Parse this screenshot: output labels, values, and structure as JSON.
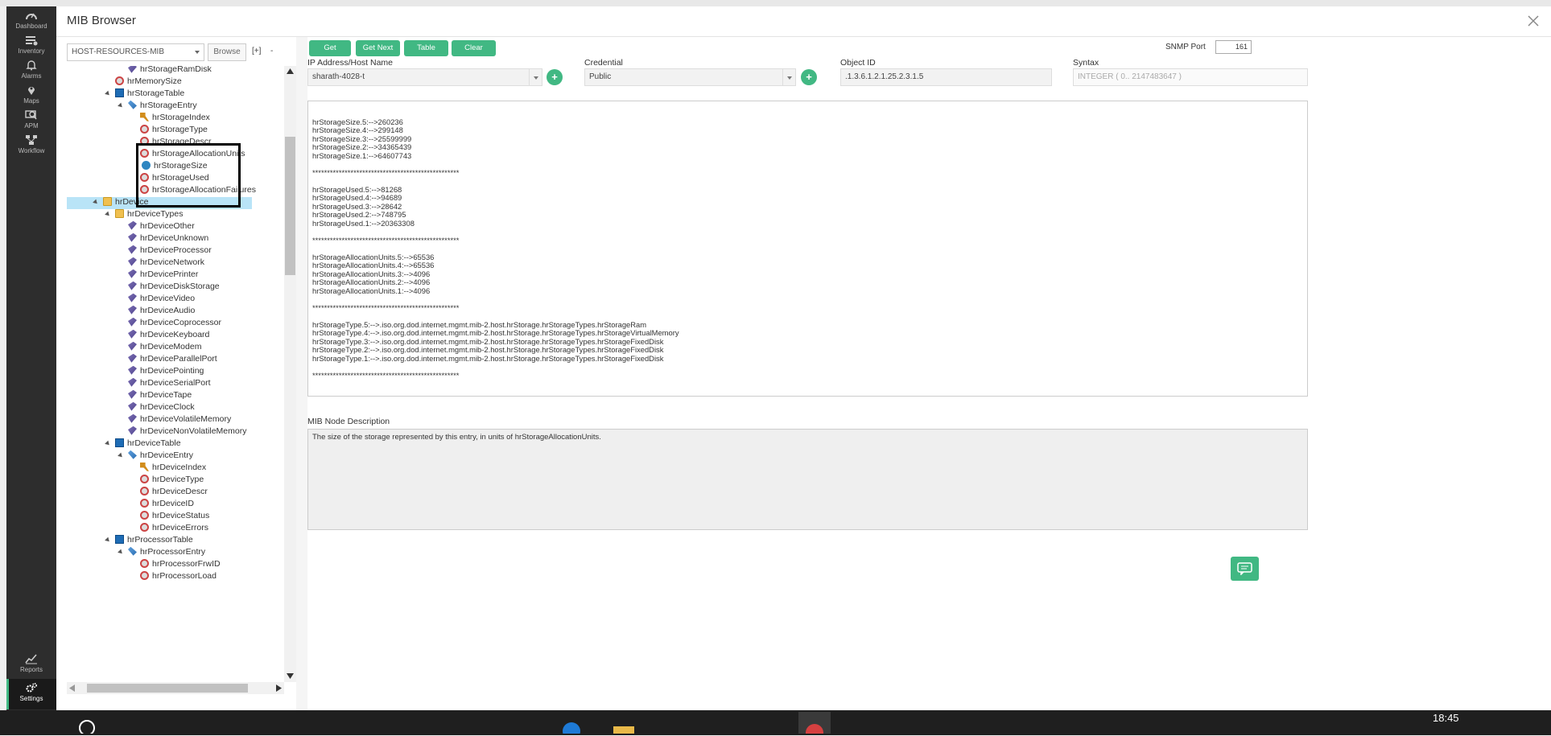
{
  "nav": {
    "items": [
      {
        "label": "Dashboard"
      },
      {
        "label": "Inventory"
      },
      {
        "label": "Alarms"
      },
      {
        "label": "Maps"
      },
      {
        "label": "APM"
      },
      {
        "label": "Workflow"
      },
      {
        "label": "Reports"
      },
      {
        "label": "Settings"
      }
    ]
  },
  "header": {
    "title": "MIB Browser"
  },
  "mib": {
    "selected": "HOST-RESOURCES-MIB",
    "browse_label": "Browse",
    "expand_label": "[+]",
    "collapse_label": "-"
  },
  "tree": {
    "nodes": [
      {
        "label": "hrStorageRamDisk"
      },
      {
        "label": "hrMemorySize"
      },
      {
        "label": "hrStorageTable"
      },
      {
        "label": "hrStorageEntry"
      },
      {
        "label": "hrStorageIndex"
      },
      {
        "label": "hrStorageType"
      },
      {
        "label": "hrStorageDescr"
      },
      {
        "label": "hrStorageAllocationUnits"
      },
      {
        "label": "hrStorageSize"
      },
      {
        "label": "hrStorageUsed"
      },
      {
        "label": "hrStorageAllocationFailures"
      },
      {
        "label": "hrDevice"
      },
      {
        "label": "hrDeviceTypes"
      },
      {
        "label": "hrDeviceOther"
      },
      {
        "label": "hrDeviceUnknown"
      },
      {
        "label": "hrDeviceProcessor"
      },
      {
        "label": "hrDeviceNetwork"
      },
      {
        "label": "hrDevicePrinter"
      },
      {
        "label": "hrDeviceDiskStorage"
      },
      {
        "label": "hrDeviceVideo"
      },
      {
        "label": "hrDeviceAudio"
      },
      {
        "label": "hrDeviceCoprocessor"
      },
      {
        "label": "hrDeviceKeyboard"
      },
      {
        "label": "hrDeviceModem"
      },
      {
        "label": "hrDeviceParallelPort"
      },
      {
        "label": "hrDevicePointing"
      },
      {
        "label": "hrDeviceSerialPort"
      },
      {
        "label": "hrDeviceTape"
      },
      {
        "label": "hrDeviceClock"
      },
      {
        "label": "hrDeviceVolatileMemory"
      },
      {
        "label": "hrDeviceNonVolatileMemory"
      },
      {
        "label": "hrDeviceTable"
      },
      {
        "label": "hrDeviceEntry"
      },
      {
        "label": "hrDeviceIndex"
      },
      {
        "label": "hrDeviceType"
      },
      {
        "label": "hrDeviceDescr"
      },
      {
        "label": "hrDeviceID"
      },
      {
        "label": "hrDeviceStatus"
      },
      {
        "label": "hrDeviceErrors"
      },
      {
        "label": "hrProcessorTable"
      },
      {
        "label": "hrProcessorEntry"
      },
      {
        "label": "hrProcessorFrwID"
      },
      {
        "label": "hrProcessorLoad"
      }
    ]
  },
  "toolbar": {
    "get": "Get",
    "get_next": "Get Next",
    "table": "Table",
    "clear": "Clear",
    "snmp_port_label": "SNMP Port",
    "snmp_port_value": "161"
  },
  "form": {
    "ip_label": "IP Address/Host Name",
    "ip_value": "sharath-4028-t",
    "credential_label": "Credential",
    "credential_value": "Public",
    "oid_label": "Object ID",
    "oid_value": ".1.3.6.1.2.1.25.2.3.1.5",
    "syntax_label": "Syntax",
    "syntax_value": "INTEGER ( 0.. 2147483647 )",
    "add_label": "+"
  },
  "output": {
    "text": "\nhrStorageSize.5:-->260236\nhrStorageSize.4:-->299148\nhrStorageSize.3:-->25599999\nhrStorageSize.2:-->34365439\nhrStorageSize.1:-->64607743\n\n**************************************************\n\nhrStorageUsed.5:-->81268\nhrStorageUsed.4:-->94689\nhrStorageUsed.3:-->28642\nhrStorageUsed.2:-->748795\nhrStorageUsed.1:-->20363308\n\n**************************************************\n\nhrStorageAllocationUnits.5:-->65536\nhrStorageAllocationUnits.4:-->65536\nhrStorageAllocationUnits.3:-->4096\nhrStorageAllocationUnits.2:-->4096\nhrStorageAllocationUnits.1:-->4096\n\n**************************************************\n\nhrStorageType.5:-->.iso.org.dod.internet.mgmt.mib-2.host.hrStorage.hrStorageTypes.hrStorageRam\nhrStorageType.4:-->.iso.org.dod.internet.mgmt.mib-2.host.hrStorage.hrStorageTypes.hrStorageVirtualMemory\nhrStorageType.3:-->.iso.org.dod.internet.mgmt.mib-2.host.hrStorage.hrStorageTypes.hrStorageFixedDisk\nhrStorageType.2:-->.iso.org.dod.internet.mgmt.mib-2.host.hrStorage.hrStorageTypes.hrStorageFixedDisk\nhrStorageType.1:-->.iso.org.dod.internet.mgmt.mib-2.host.hrStorage.hrStorageTypes.hrStorageFixedDisk\n\n**************************************************"
  },
  "description": {
    "label": "MIB Node Description",
    "text": "The size of the storage represented by this entry, in units of hrStorageAllocationUnits."
  },
  "taskbar": {
    "time": "18:45"
  },
  "colors": {
    "accent": "#41b883",
    "nav_bg": "#2d2d2d",
    "selection": "#b9e4f7"
  }
}
